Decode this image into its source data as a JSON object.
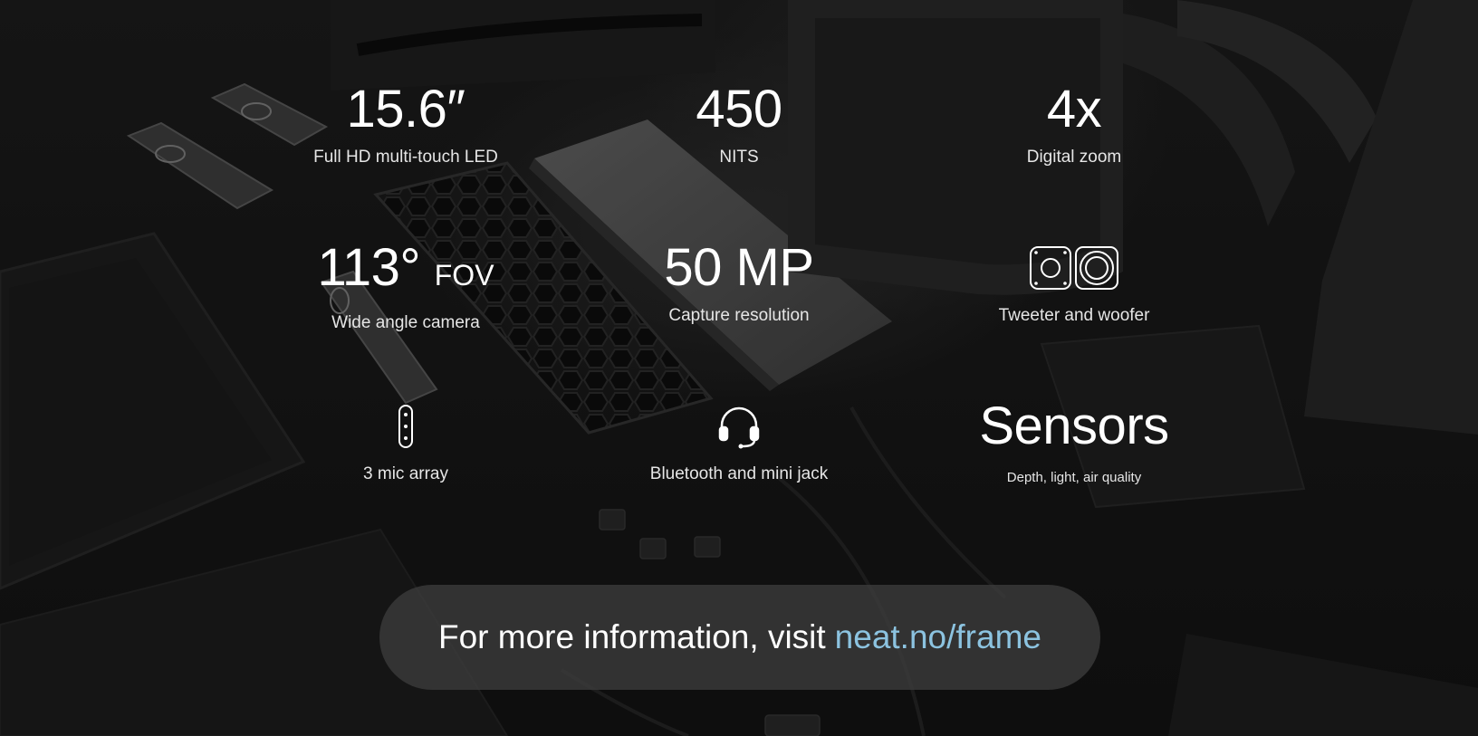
{
  "specs": [
    {
      "id": "display",
      "value": "15.6″",
      "label": "Full HD multi-touch LED"
    },
    {
      "id": "brightness",
      "value": "450",
      "label": "NITS"
    },
    {
      "id": "zoom",
      "value": "4x",
      "label": "Digital zoom"
    },
    {
      "id": "fov",
      "value": "113°",
      "unit": "FOV",
      "label": "Wide angle camera"
    },
    {
      "id": "resolution",
      "value": "50 MP",
      "label": "Capture resolution"
    },
    {
      "id": "speakers",
      "icon": "speaker-icon",
      "label": "Tweeter and woofer"
    },
    {
      "id": "mics",
      "icon": "microphone-icon",
      "label": "3 mic array"
    },
    {
      "id": "audio",
      "icon": "headset-icon",
      "label": "Bluetooth and mini jack"
    },
    {
      "id": "sensors",
      "value": "Sensors",
      "label": "Depth, light, air quality"
    }
  ],
  "info": {
    "text": "For more information, visit",
    "link": "neat.no/frame",
    "link_color": "#8cc3e0"
  }
}
